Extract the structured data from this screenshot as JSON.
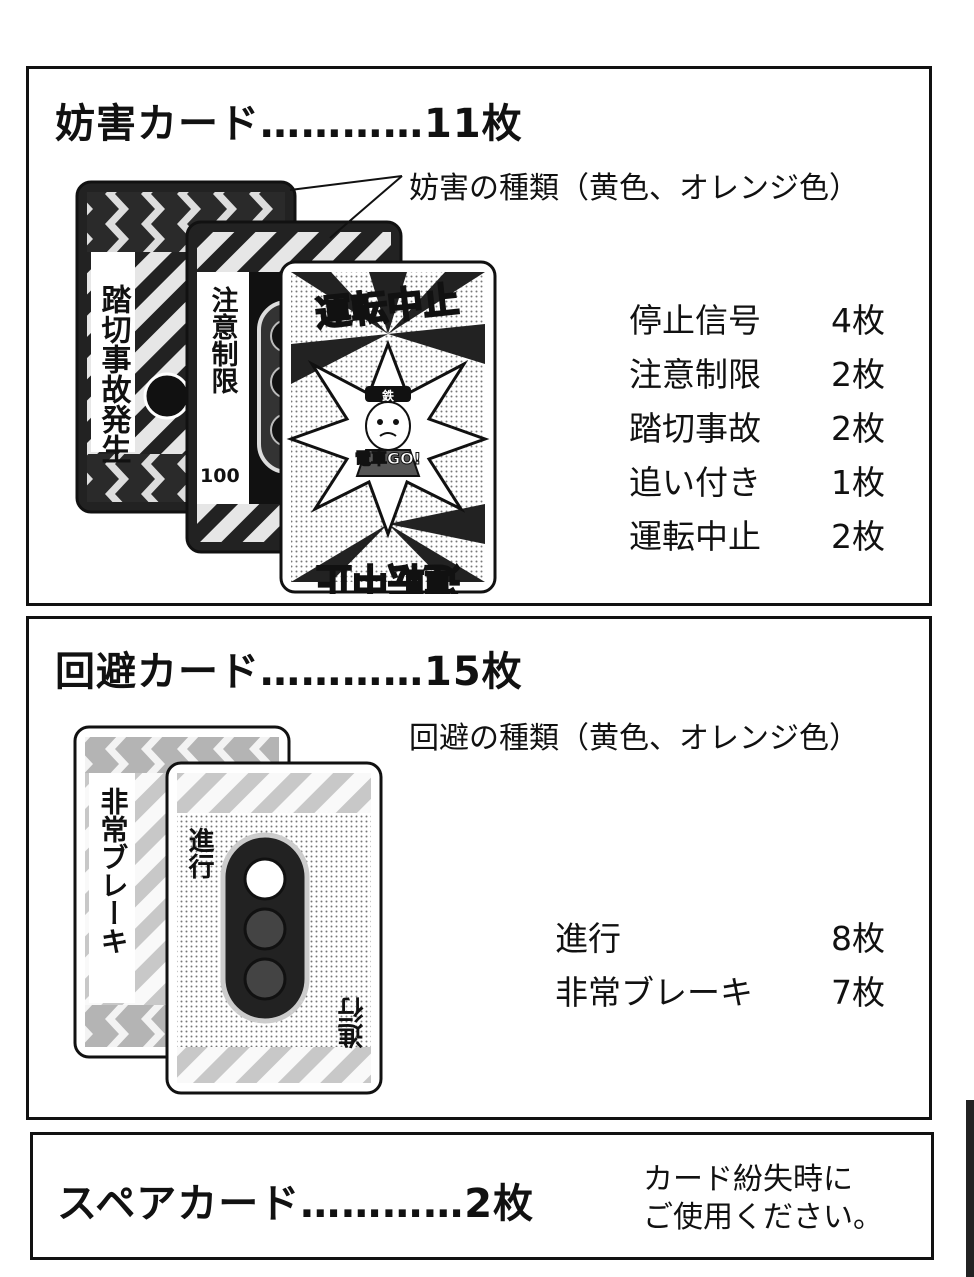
{
  "sections": {
    "obstruction": {
      "title": "妨害カード…………11枚",
      "callout": "妨害の種類（黄色、オレンジ色）",
      "items": [
        {
          "name": "停止信号",
          "count": "4枚"
        },
        {
          "name": "注意制限",
          "count": "2枚"
        },
        {
          "name": "踏切事故",
          "count": "2枚"
        },
        {
          "name": "追い付き",
          "count": "1枚"
        },
        {
          "name": "運転中止",
          "count": "2枚"
        }
      ],
      "card_labels": {
        "back_card": "踏切事故発生",
        "middle_card": "注意制限",
        "middle_card_number": "100",
        "front_card_top": "運転中止",
        "front_card_bottom": "運転中止",
        "front_card_badge": "鉄",
        "front_card_stamp": "電車GO!"
      }
    },
    "avoidance": {
      "title": "回避カード…………15枚",
      "callout": "回避の種類（黄色、オレンジ色）",
      "items": [
        {
          "name": "進行",
          "count": "8枚"
        },
        {
          "name": "非常ブレーキ",
          "count": "7枚"
        }
      ],
      "card_labels": {
        "back_card": "非常ブレーキ",
        "front_card_top": "進行",
        "front_card_bottom": "進行"
      }
    },
    "spare": {
      "title": "スペアカード…………2枚",
      "note_lines": [
        "カード紛失時に",
        "ご使用ください。"
      ]
    }
  }
}
